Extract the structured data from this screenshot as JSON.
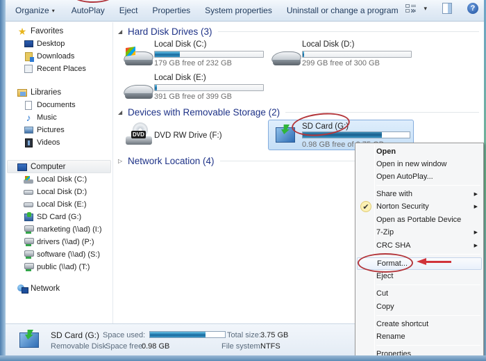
{
  "toolbar": {
    "organize": "Organize",
    "autoplay": "AutoPlay",
    "eject": "Eject",
    "properties": "Properties",
    "system_properties": "System properties",
    "uninstall": "Uninstall or change a program",
    "more": "»",
    "dropdown_caret": "▾",
    "help": "?"
  },
  "nav": {
    "favorites": {
      "label": "Favorites",
      "items": [
        {
          "label": "Desktop",
          "icon": "desktop-icon"
        },
        {
          "label": "Downloads",
          "icon": "downloads-icon"
        },
        {
          "label": "Recent Places",
          "icon": "recent-places-icon"
        }
      ]
    },
    "libraries": {
      "label": "Libraries",
      "items": [
        {
          "label": "Documents",
          "icon": "documents-icon"
        },
        {
          "label": "Music",
          "icon": "music-icon"
        },
        {
          "label": "Pictures",
          "icon": "pictures-icon"
        },
        {
          "label": "Videos",
          "icon": "videos-icon"
        }
      ]
    },
    "computer": {
      "label": "Computer",
      "items": [
        {
          "label": "Local Disk (C:)",
          "icon": "system-disk-icon"
        },
        {
          "label": "Local Disk (D:)",
          "icon": "disk-icon"
        },
        {
          "label": "Local Disk (E:)",
          "icon": "disk-icon"
        },
        {
          "label": "SD Card (G:)",
          "icon": "sd-card-icon"
        },
        {
          "label": "marketing (\\\\ad) (I:)",
          "icon": "network-drive-icon"
        },
        {
          "label": "drivers (\\\\ad) (P:)",
          "icon": "network-drive-icon"
        },
        {
          "label": "software (\\\\ad) (S:)",
          "icon": "network-drive-icon"
        },
        {
          "label": "public (\\\\ad) (T:)",
          "icon": "network-drive-icon"
        }
      ]
    },
    "network": {
      "label": "Network"
    }
  },
  "content": {
    "groups": {
      "hard_disks": "Hard Disk Drives (3)",
      "removable": "Devices with Removable Storage (2)",
      "network": "Network Location (4)"
    },
    "drives": {
      "c": {
        "name": "Local Disk (C:)",
        "free": "179 GB free of 232 GB",
        "used_fraction": 0.23
      },
      "d": {
        "name": "Local Disk (D:)",
        "free": "299 GB free of 300 GB",
        "used_fraction": 0.003
      },
      "e": {
        "name": "Local Disk (E:)",
        "free": "391 GB free of 399 GB",
        "used_fraction": 0.02
      },
      "f": {
        "name": "DVD RW Drive (F:)",
        "dvd_label": "DVD"
      },
      "g": {
        "name": "SD Card (G:)",
        "free": "0.98 GB free of 3.75 GB",
        "used_fraction": 0.74
      }
    }
  },
  "context_menu": {
    "items": [
      {
        "label": "Open",
        "bold": true
      },
      {
        "label": "Open in new window"
      },
      {
        "label": "Open AutoPlay..."
      },
      {
        "label": "Share with",
        "submenu": true
      },
      {
        "label": "Norton Security",
        "submenu": true,
        "checked": true
      },
      {
        "label": "Open as Portable Device"
      },
      {
        "label": "7-Zip",
        "submenu": true
      },
      {
        "label": "CRC SHA",
        "submenu": true
      },
      {
        "label": "Format...",
        "highlighted": true
      },
      {
        "label": "Eject"
      },
      {
        "label": "Cut"
      },
      {
        "label": "Copy"
      },
      {
        "label": "Create shortcut"
      },
      {
        "label": "Rename"
      },
      {
        "label": "Properties"
      }
    ],
    "submenu_arrow": "▶",
    "check_mark": "✔"
  },
  "details": {
    "name": "SD Card (G:)",
    "type": "Removable Disk",
    "space_used_label": "Space used:",
    "space_used_fraction": 0.74,
    "space_free_label": "Space free:",
    "space_free_value": "0.98 GB",
    "total_size_label": "Total size:",
    "total_size_value": "3.75 GB",
    "file_system_label": "File system:",
    "file_system_value": "NTFS"
  },
  "annotations": {
    "accent_red": "#b3353a"
  }
}
